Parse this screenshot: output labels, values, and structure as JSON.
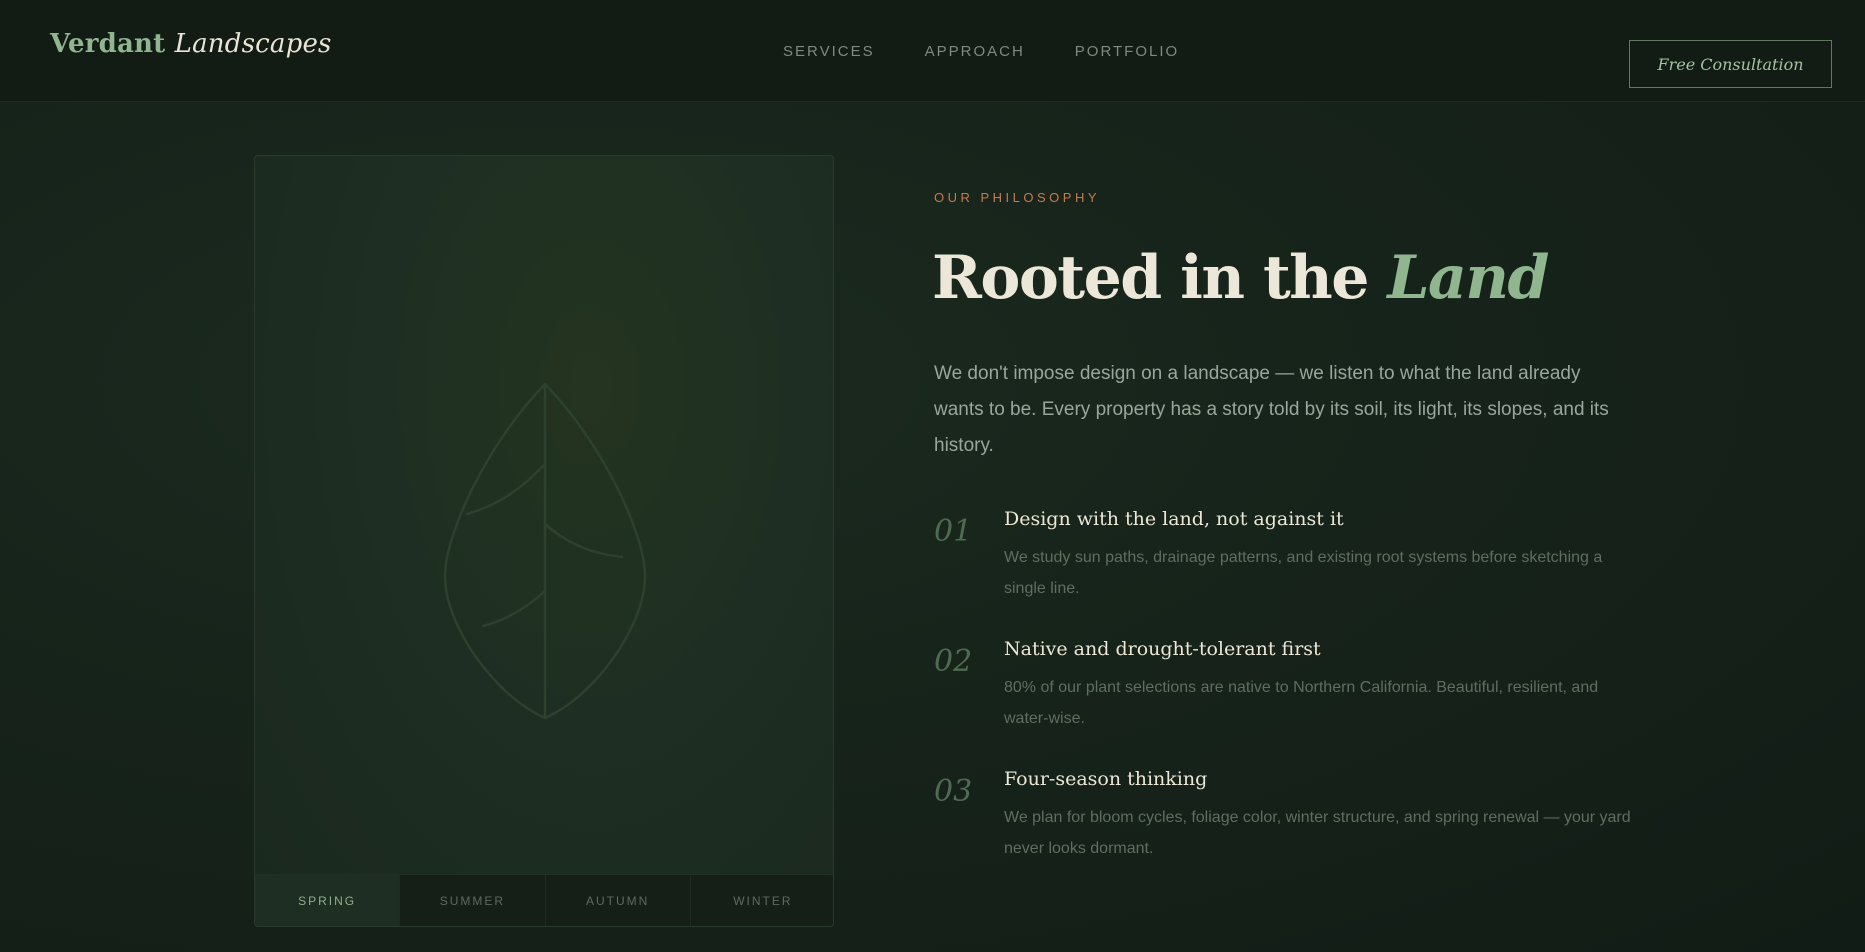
{
  "brand": {
    "name_bold": "Verdant",
    "name_italic": "Landscapes"
  },
  "nav": {
    "items": [
      {
        "label": "SERVICES"
      },
      {
        "label": "APPROACH"
      },
      {
        "label": "PORTFOLIO"
      }
    ]
  },
  "cta": {
    "label": "Free Consultation"
  },
  "card": {
    "icon": "leaf-icon",
    "seasons": [
      {
        "label": "SPRING",
        "active": true
      },
      {
        "label": "SUMMER",
        "active": false
      },
      {
        "label": "AUTUMN",
        "active": false
      },
      {
        "label": "WINTER",
        "active": false
      }
    ]
  },
  "section": {
    "eyebrow": "OUR PHILOSOPHY",
    "heading_main": "Rooted in the ",
    "heading_accent": "Land",
    "intro": "We don't impose design on a landscape — we listen to what the land already wants to be. Every property has a story told by its soil, its light, its slopes, and its history.",
    "principles": [
      {
        "number": "01",
        "title": "Design with the land, not against it",
        "description": "We study sun paths, drainage patterns, and existing root systems before sketching a single line."
      },
      {
        "number": "02",
        "title": "Native and drought-tolerant first",
        "description": "80% of our plant selections are native to Northern California. Beautiful, resilient, and water-wise."
      },
      {
        "number": "03",
        "title": "Four-season thinking",
        "description": "We plan for bloom cycles, foliage color, winter structure, and spring renewal — your yard never looks dormant."
      }
    ]
  },
  "colors": {
    "background": "#16231a",
    "accent_green": "#8fb68f",
    "accent_orange": "#c77a4c",
    "text_light": "#ece7d8"
  }
}
